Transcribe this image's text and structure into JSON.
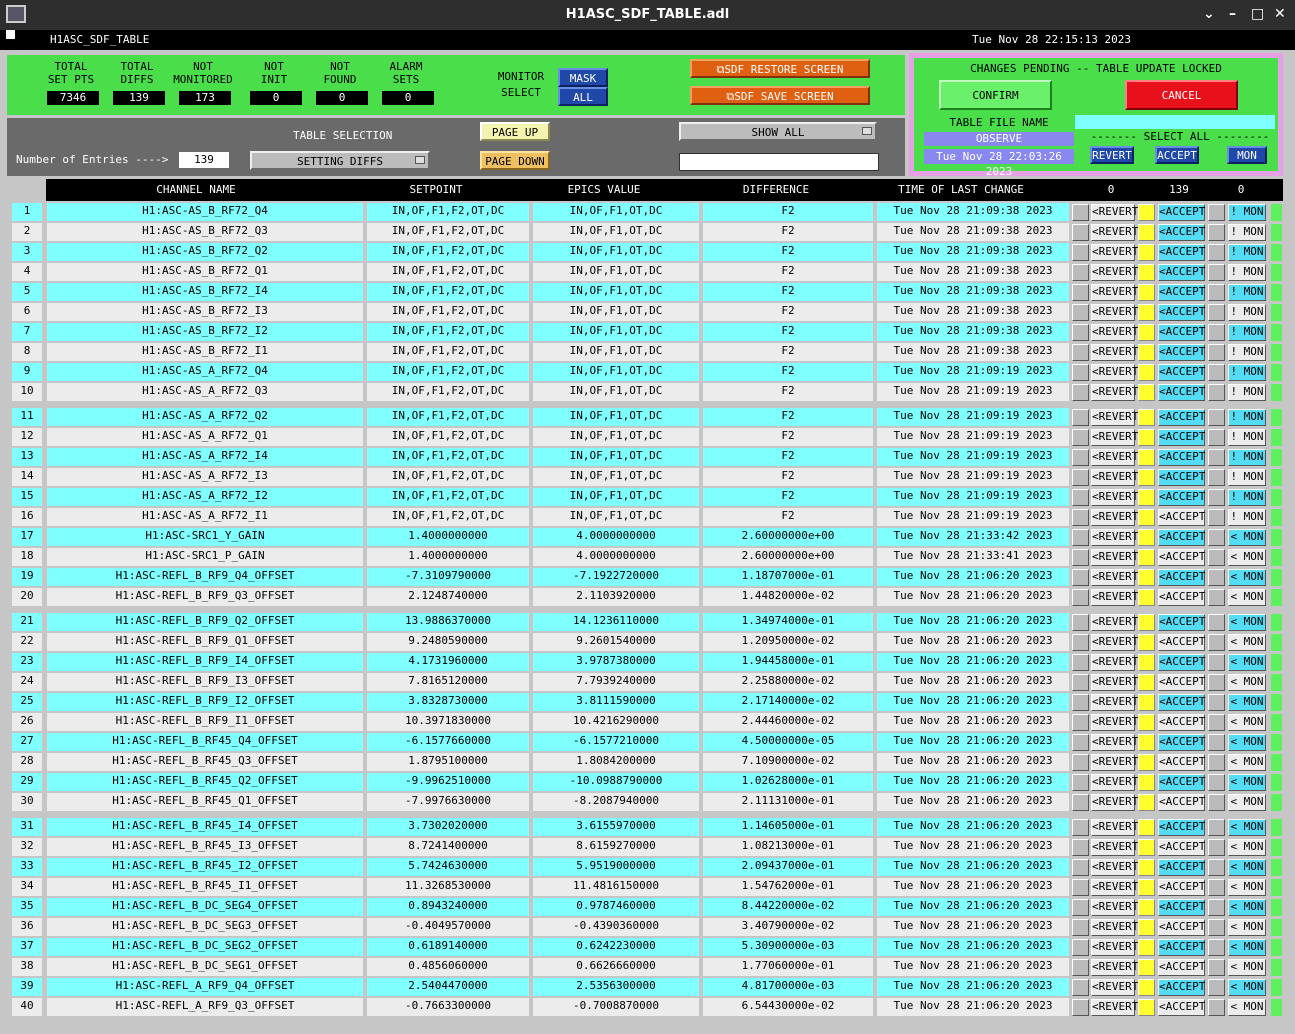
{
  "window": {
    "title": "H1ASC_SDF_TABLE.adl",
    "minimize": "–",
    "maximize": "□",
    "close": "✕"
  },
  "header": {
    "screen_name": "H1ASC_SDF_TABLE",
    "datetime": "Tue Nov 28 22:15:13 2023"
  },
  "summary": {
    "stats": [
      {
        "l1": "TOTAL",
        "l2": "SET PTS",
        "value": "7346"
      },
      {
        "l1": "TOTAL",
        "l2": "DIFFS",
        "value": "139"
      },
      {
        "l1": "NOT",
        "l2": "MONITORED",
        "value": "173"
      },
      {
        "l1": "NOT",
        "l2": "INIT",
        "value": "0"
      },
      {
        "l1": "NOT",
        "l2": "FOUND",
        "value": "0"
      },
      {
        "l1": "ALARM",
        "l2": "SETS",
        "value": "0"
      }
    ],
    "monitor_l1": "MONITOR",
    "monitor_l2": "SELECT",
    "mask": "MASK",
    "all": "ALL",
    "restore": "SDF RESTORE SCREEN",
    "save": "SDF SAVE SCREEN"
  },
  "control": {
    "table_selection": "TABLE SELECTION",
    "entries_label": "Number of Entries ---->",
    "entries_value": "139",
    "table_select_value": "SETTING DIFFS",
    "page_up": "PAGE UP",
    "page_down": "PAGE DOWN",
    "show_all": "SHOW ALL",
    "filter_value": ""
  },
  "pending": {
    "title": "CHANGES PENDING -- TABLE UPDATE LOCKED",
    "confirm": "CONFIRM",
    "cancel": "CANCEL",
    "table_file_label": "TABLE FILE NAME",
    "table_file_name": "OBSERVE",
    "table_file_value": "",
    "file_time": "Tue Nov 28 22:03:26 2023",
    "select_all": "------- SELECT ALL --------",
    "revert": "REVERT",
    "accept": "ACCEPT",
    "mon": "MON"
  },
  "table": {
    "headers": [
      "CHANNEL NAME",
      "SETPOINT",
      "EPICS VALUE",
      "DIFFERENCE",
      "TIME OF LAST CHANGE"
    ],
    "count_revert": "0",
    "count_accept": "139",
    "count_mon": "0",
    "revert_label": "<REVERT",
    "accept_label": "<ACCEPT",
    "rows": [
      {
        "n": "1",
        "name": "H1:ASC-AS_B_RF72_Q4",
        "sp": "IN,OF,F1,F2,OT,DC",
        "ev": "IN,OF,F1,OT,DC",
        "diff": "F2",
        "time": "Tue Nov 28 21:09:38 2023",
        "mon": "! MON",
        "accept_on": true,
        "mon_on": true
      },
      {
        "n": "2",
        "name": "H1:ASC-AS_B_RF72_Q3",
        "sp": "IN,OF,F1,F2,OT,DC",
        "ev": "IN,OF,F1,OT,DC",
        "diff": "F2",
        "time": "Tue Nov 28 21:09:38 2023",
        "mon": "! MON",
        "accept_on": true,
        "mon_on": false
      },
      {
        "n": "3",
        "name": "H1:ASC-AS_B_RF72_Q2",
        "sp": "IN,OF,F1,F2,OT,DC",
        "ev": "IN,OF,F1,OT,DC",
        "diff": "F2",
        "time": "Tue Nov 28 21:09:38 2023",
        "mon": "! MON",
        "accept_on": true,
        "mon_on": true
      },
      {
        "n": "4",
        "name": "H1:ASC-AS_B_RF72_Q1",
        "sp": "IN,OF,F1,F2,OT,DC",
        "ev": "IN,OF,F1,OT,DC",
        "diff": "F2",
        "time": "Tue Nov 28 21:09:38 2023",
        "mon": "! MON",
        "accept_on": true,
        "mon_on": false
      },
      {
        "n": "5",
        "name": "H1:ASC-AS_B_RF72_I4",
        "sp": "IN,OF,F1,F2,OT,DC",
        "ev": "IN,OF,F1,OT,DC",
        "diff": "F2",
        "time": "Tue Nov 28 21:09:38 2023",
        "mon": "! MON",
        "accept_on": true,
        "mon_on": true
      },
      {
        "n": "6",
        "name": "H1:ASC-AS_B_RF72_I3",
        "sp": "IN,OF,F1,F2,OT,DC",
        "ev": "IN,OF,F1,OT,DC",
        "diff": "F2",
        "time": "Tue Nov 28 21:09:38 2023",
        "mon": "! MON",
        "accept_on": true,
        "mon_on": false
      },
      {
        "n": "7",
        "name": "H1:ASC-AS_B_RF72_I2",
        "sp": "IN,OF,F1,F2,OT,DC",
        "ev": "IN,OF,F1,OT,DC",
        "diff": "F2",
        "time": "Tue Nov 28 21:09:38 2023",
        "mon": "! MON",
        "accept_on": true,
        "mon_on": true
      },
      {
        "n": "8",
        "name": "H1:ASC-AS_B_RF72_I1",
        "sp": "IN,OF,F1,F2,OT,DC",
        "ev": "IN,OF,F1,OT,DC",
        "diff": "F2",
        "time": "Tue Nov 28 21:09:38 2023",
        "mon": "! MON",
        "accept_on": true,
        "mon_on": false
      },
      {
        "n": "9",
        "name": "H1:ASC-AS_A_RF72_Q4",
        "sp": "IN,OF,F1,F2,OT,DC",
        "ev": "IN,OF,F1,OT,DC",
        "diff": "F2",
        "time": "Tue Nov 28 21:09:19 2023",
        "mon": "! MON",
        "accept_on": true,
        "mon_on": true
      },
      {
        "n": "10",
        "name": "H1:ASC-AS_A_RF72_Q3",
        "sp": "IN,OF,F1,F2,OT,DC",
        "ev": "IN,OF,F1,OT,DC",
        "diff": "F2",
        "time": "Tue Nov 28 21:09:19 2023",
        "mon": "! MON",
        "accept_on": true,
        "mon_on": false
      },
      {
        "n": "11",
        "name": "H1:ASC-AS_A_RF72_Q2",
        "sp": "IN,OF,F1,F2,OT,DC",
        "ev": "IN,OF,F1,OT,DC",
        "diff": "F2",
        "time": "Tue Nov 28 21:09:19 2023",
        "mon": "! MON",
        "accept_on": true,
        "mon_on": true
      },
      {
        "n": "12",
        "name": "H1:ASC-AS_A_RF72_Q1",
        "sp": "IN,OF,F1,F2,OT,DC",
        "ev": "IN,OF,F1,OT,DC",
        "diff": "F2",
        "time": "Tue Nov 28 21:09:19 2023",
        "mon": "! MON",
        "accept_on": true,
        "mon_on": false
      },
      {
        "n": "13",
        "name": "H1:ASC-AS_A_RF72_I4",
        "sp": "IN,OF,F1,F2,OT,DC",
        "ev": "IN,OF,F1,OT,DC",
        "diff": "F2",
        "time": "Tue Nov 28 21:09:19 2023",
        "mon": "! MON",
        "accept_on": true,
        "mon_on": true
      },
      {
        "n": "14",
        "name": "H1:ASC-AS_A_RF72_I3",
        "sp": "IN,OF,F1,F2,OT,DC",
        "ev": "IN,OF,F1,OT,DC",
        "diff": "F2",
        "time": "Tue Nov 28 21:09:19 2023",
        "mon": "! MON",
        "accept_on": true,
        "mon_on": false
      },
      {
        "n": "15",
        "name": "H1:ASC-AS_A_RF72_I2",
        "sp": "IN,OF,F1,F2,OT,DC",
        "ev": "IN,OF,F1,OT,DC",
        "diff": "F2",
        "time": "Tue Nov 28 21:09:19 2023",
        "mon": "! MON",
        "accept_on": true,
        "mon_on": true
      },
      {
        "n": "16",
        "name": "H1:ASC-AS_A_RF72_I1",
        "sp": "IN,OF,F1,F2,OT,DC",
        "ev": "IN,OF,F1,OT,DC",
        "diff": "F2",
        "time": "Tue Nov 28 21:09:19 2023",
        "mon": "! MON",
        "accept_on": false,
        "mon_on": false
      },
      {
        "n": "17",
        "name": "H1:ASC-SRC1_Y_GAIN",
        "sp": "1.4000000000",
        "ev": "4.0000000000",
        "diff": "2.60000000e+00",
        "time": "Tue Nov 28 21:33:42 2023",
        "mon": "< MON",
        "accept_on": true,
        "mon_on": true
      },
      {
        "n": "18",
        "name": "H1:ASC-SRC1_P_GAIN",
        "sp": "1.4000000000",
        "ev": "4.0000000000",
        "diff": "2.60000000e+00",
        "time": "Tue Nov 28 21:33:41 2023",
        "mon": "< MON",
        "accept_on": false,
        "mon_on": false
      },
      {
        "n": "19",
        "name": "H1:ASC-REFL_B_RF9_Q4_OFFSET",
        "sp": "-7.3109790000",
        "ev": "-7.1922720000",
        "diff": "1.18707000e-01",
        "time": "Tue Nov 28 21:06:20 2023",
        "mon": "< MON",
        "accept_on": true,
        "mon_on": true
      },
      {
        "n": "20",
        "name": "H1:ASC-REFL_B_RF9_Q3_OFFSET",
        "sp": "2.1248740000",
        "ev": "2.1103920000",
        "diff": "1.44820000e-02",
        "time": "Tue Nov 28 21:06:20 2023",
        "mon": "< MON",
        "accept_on": false,
        "mon_on": false
      },
      {
        "n": "21",
        "name": "H1:ASC-REFL_B_RF9_Q2_OFFSET",
        "sp": "13.9886370000",
        "ev": "14.1236110000",
        "diff": "1.34974000e-01",
        "time": "Tue Nov 28 21:06:20 2023",
        "mon": "< MON",
        "accept_on": true,
        "mon_on": true
      },
      {
        "n": "22",
        "name": "H1:ASC-REFL_B_RF9_Q1_OFFSET",
        "sp": "9.2480590000",
        "ev": "9.2601540000",
        "diff": "1.20950000e-02",
        "time": "Tue Nov 28 21:06:20 2023",
        "mon": "< MON",
        "accept_on": false,
        "mon_on": false
      },
      {
        "n": "23",
        "name": "H1:ASC-REFL_B_RF9_I4_OFFSET",
        "sp": "4.1731960000",
        "ev": "3.9787380000",
        "diff": "1.94458000e-01",
        "time": "Tue Nov 28 21:06:20 2023",
        "mon": "< MON",
        "accept_on": true,
        "mon_on": true
      },
      {
        "n": "24",
        "name": "H1:ASC-REFL_B_RF9_I3_OFFSET",
        "sp": "7.8165120000",
        "ev": "7.7939240000",
        "diff": "2.25880000e-02",
        "time": "Tue Nov 28 21:06:20 2023",
        "mon": "< MON",
        "accept_on": false,
        "mon_on": false
      },
      {
        "n": "25",
        "name": "H1:ASC-REFL_B_RF9_I2_OFFSET",
        "sp": "3.8328730000",
        "ev": "3.8111590000",
        "diff": "2.17140000e-02",
        "time": "Tue Nov 28 21:06:20 2023",
        "mon": "< MON",
        "accept_on": true,
        "mon_on": true
      },
      {
        "n": "26",
        "name": "H1:ASC-REFL_B_RF9_I1_OFFSET",
        "sp": "10.3971830000",
        "ev": "10.4216290000",
        "diff": "2.44460000e-02",
        "time": "Tue Nov 28 21:06:20 2023",
        "mon": "< MON",
        "accept_on": false,
        "mon_on": false
      },
      {
        "n": "27",
        "name": "H1:ASC-REFL_B_RF45_Q4_OFFSET",
        "sp": "-6.1577660000",
        "ev": "-6.1577210000",
        "diff": "4.50000000e-05",
        "time": "Tue Nov 28 21:06:20 2023",
        "mon": "< MON",
        "accept_on": true,
        "mon_on": true
      },
      {
        "n": "28",
        "name": "H1:ASC-REFL_B_RF45_Q3_OFFSET",
        "sp": "1.8795100000",
        "ev": "1.8084200000",
        "diff": "7.10900000e-02",
        "time": "Tue Nov 28 21:06:20 2023",
        "mon": "< MON",
        "accept_on": false,
        "mon_on": false
      },
      {
        "n": "29",
        "name": "H1:ASC-REFL_B_RF45_Q2_OFFSET",
        "sp": "-9.9962510000",
        "ev": "-10.0988790000",
        "diff": "1.02628000e-01",
        "time": "Tue Nov 28 21:06:20 2023",
        "mon": "< MON",
        "accept_on": true,
        "mon_on": true
      },
      {
        "n": "30",
        "name": "H1:ASC-REFL_B_RF45_Q1_OFFSET",
        "sp": "-7.9976630000",
        "ev": "-8.2087940000",
        "diff": "2.11131000e-01",
        "time": "Tue Nov 28 21:06:20 2023",
        "mon": "< MON",
        "accept_on": false,
        "mon_on": false
      },
      {
        "n": "31",
        "name": "H1:ASC-REFL_B_RF45_I4_OFFSET",
        "sp": "3.7302020000",
        "ev": "3.6155970000",
        "diff": "1.14605000e-01",
        "time": "Tue Nov 28 21:06:20 2023",
        "mon": "< MON",
        "accept_on": true,
        "mon_on": true
      },
      {
        "n": "32",
        "name": "H1:ASC-REFL_B_RF45_I3_OFFSET",
        "sp": "8.7241400000",
        "ev": "8.6159270000",
        "diff": "1.08213000e-01",
        "time": "Tue Nov 28 21:06:20 2023",
        "mon": "< MON",
        "accept_on": false,
        "mon_on": false
      },
      {
        "n": "33",
        "name": "H1:ASC-REFL_B_RF45_I2_OFFSET",
        "sp": "5.7424630000",
        "ev": "5.9519000000",
        "diff": "2.09437000e-01",
        "time": "Tue Nov 28 21:06:20 2023",
        "mon": "< MON",
        "accept_on": true,
        "mon_on": true
      },
      {
        "n": "34",
        "name": "H1:ASC-REFL_B_RF45_I1_OFFSET",
        "sp": "11.3268530000",
        "ev": "11.4816150000",
        "diff": "1.54762000e-01",
        "time": "Tue Nov 28 21:06:20 2023",
        "mon": "< MON",
        "accept_on": false,
        "mon_on": false
      },
      {
        "n": "35",
        "name": "H1:ASC-REFL_B_DC_SEG4_OFFSET",
        "sp": "0.8943240000",
        "ev": "0.9787460000",
        "diff": "8.44220000e-02",
        "time": "Tue Nov 28 21:06:20 2023",
        "mon": "< MON",
        "accept_on": true,
        "mon_on": true
      },
      {
        "n": "36",
        "name": "H1:ASC-REFL_B_DC_SEG3_OFFSET",
        "sp": "-0.4049570000",
        "ev": "-0.4390360000",
        "diff": "3.40790000e-02",
        "time": "Tue Nov 28 21:06:20 2023",
        "mon": "< MON",
        "accept_on": false,
        "mon_on": false
      },
      {
        "n": "37",
        "name": "H1:ASC-REFL_B_DC_SEG2_OFFSET",
        "sp": "0.6189140000",
        "ev": "0.6242230000",
        "diff": "5.30900000e-03",
        "time": "Tue Nov 28 21:06:20 2023",
        "mon": "< MON",
        "accept_on": true,
        "mon_on": true
      },
      {
        "n": "38",
        "name": "H1:ASC-REFL_B_DC_SEG1_OFFSET",
        "sp": "0.4856060000",
        "ev": "0.6626660000",
        "diff": "1.77060000e-01",
        "time": "Tue Nov 28 21:06:20 2023",
        "mon": "< MON",
        "accept_on": false,
        "mon_on": false
      },
      {
        "n": "39",
        "name": "H1:ASC-REFL_A_RF9_Q4_OFFSET",
        "sp": "2.5404470000",
        "ev": "2.5356300000",
        "diff": "4.81700000e-03",
        "time": "Tue Nov 28 21:06:20 2023",
        "mon": "< MON",
        "accept_on": true,
        "mon_on": true
      },
      {
        "n": "40",
        "name": "H1:ASC-REFL_A_RF9_Q3_OFFSET",
        "sp": "-0.7663300000",
        "ev": "-0.7008870000",
        "diff": "6.54430000e-02",
        "time": "Tue Nov 28 21:06:20 2023",
        "mon": "< MON",
        "accept_on": false,
        "mon_on": false
      }
    ]
  }
}
